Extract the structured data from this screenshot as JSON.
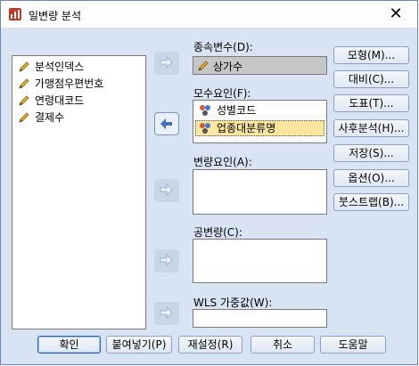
{
  "window": {
    "title": "일변량 분석",
    "close_glyph": "✕"
  },
  "source_list": {
    "items": [
      {
        "label": "분석인덱스",
        "icon": "scale-pencil-icon"
      },
      {
        "label": "가맹점우편번호",
        "icon": "scale-pencil-icon"
      },
      {
        "label": "연령대코드",
        "icon": "scale-pencil-icon"
      },
      {
        "label": "결제수",
        "icon": "scale-pencil-icon"
      }
    ]
  },
  "dependent": {
    "label": "종속변수(D):",
    "value": "상가수"
  },
  "fixed_factors": {
    "label": "모수요인(F):",
    "items": [
      {
        "label": "성별코드",
        "icon": "nominal-icon"
      },
      {
        "label": "업종대분류명",
        "icon": "nominal-icon",
        "selected": true
      }
    ]
  },
  "random_factors": {
    "label": "변량요인(A):"
  },
  "covariates": {
    "label": "공변량(C):"
  },
  "wls_weight": {
    "label": "WLS 가중값(W):"
  },
  "side_buttons": {
    "model": "모형(M)...",
    "contrasts": "대비(C)...",
    "plots": "도표(T)...",
    "post_hoc": "사후분석(H)...",
    "save": "저장(S)...",
    "options": "옵션(O)...",
    "bootstrap": "붓스트랩(B)..."
  },
  "bottom_buttons": {
    "ok": "확인",
    "paste": "붙여넣기(P)",
    "reset": "재설정(R)",
    "cancel": "취소",
    "help": "도움말"
  },
  "colors": {
    "dialog_bg": "#d8e4f3",
    "selection": "#fbe69f",
    "accent_arrow": "#3f6fc2"
  }
}
